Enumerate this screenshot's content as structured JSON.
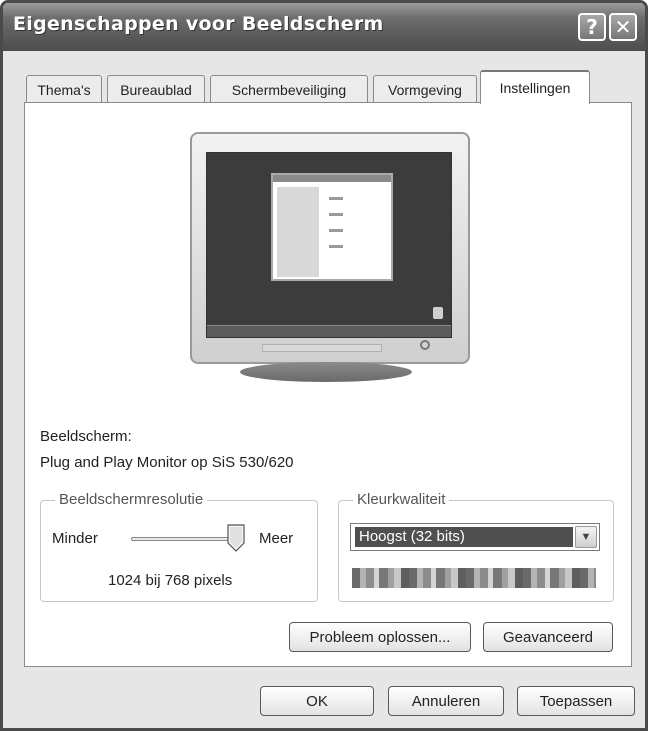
{
  "window": {
    "title": "Eigenschappen voor Beeldscherm"
  },
  "titlebar": {
    "help_label": "?",
    "close_label": "✕"
  },
  "tabs": [
    {
      "label": "Thema's"
    },
    {
      "label": "Bureaublad"
    },
    {
      "label": "Schermbeveiliging"
    },
    {
      "label": "Vormgeving"
    },
    {
      "label": "Instellingen",
      "active": true
    }
  ],
  "display": {
    "label": "Beeldscherm:",
    "value": "Plug and Play Monitor op SiS 530/620"
  },
  "resolution": {
    "group_label": "Beeldschermresolutie",
    "less_label": "Minder",
    "more_label": "Meer",
    "value_text": "1024 bij 768 pixels",
    "slider_level": 1.0
  },
  "color_quality": {
    "group_label": "Kleurkwaliteit",
    "selected": "Hoogst (32 bits)"
  },
  "buttons": {
    "troubleshoot": "Probleem oplossen...",
    "advanced": "Geavanceerd",
    "ok": "OK",
    "cancel": "Annuleren",
    "apply": "Toepassen"
  }
}
